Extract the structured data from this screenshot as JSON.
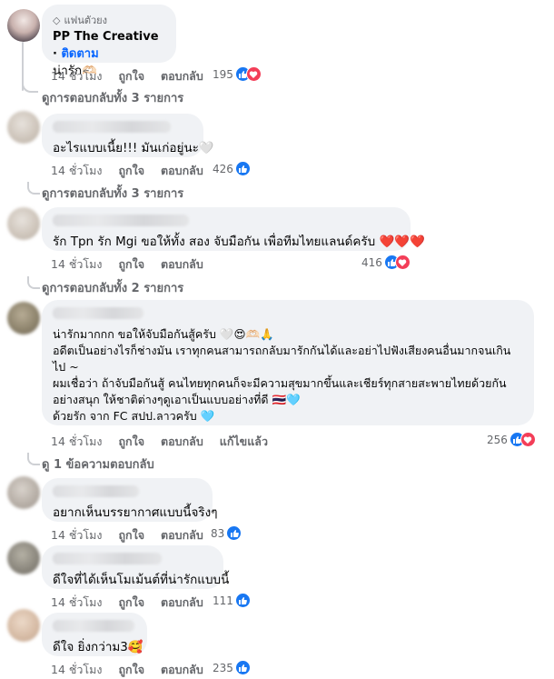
{
  "comments": [
    {
      "badge": "แฟนตัวยง",
      "name": "PP The Creative",
      "follow": "ติดตาม",
      "text": "น่ารัก🫶🏻",
      "time": "14 ชั่วโมง",
      "like": "ถูกใจ",
      "reply": "ตอบกลับ",
      "reaction_count": "195",
      "reaction_types": [
        "like",
        "love"
      ],
      "view_replies": "ดูการตอบกลับทั้ง 3 รายการ"
    },
    {
      "text": "อะไรแบบเนี้ย!!! มันเก่อยู่นะ🤍",
      "time": "14 ชั่วโมง",
      "like": "ถูกใจ",
      "reply": "ตอบกลับ",
      "reaction_count": "426",
      "reaction_types": [
        "like"
      ],
      "view_replies": "ดูการตอบกลับทั้ง 3 รายการ"
    },
    {
      "text": "รัก Tpn รัก Mgi ขอให้ทั้ง สอง จับมือกัน เพื่อทีมไทยแลนด์ครับ ❤️❤️❤️",
      "time": "14 ชั่วโมง",
      "like": "ถูกใจ",
      "reply": "ตอบกลับ",
      "reaction_count": "416",
      "reaction_types": [
        "like",
        "love"
      ],
      "view_replies": "ดูการตอบกลับทั้ง 2 รายการ"
    },
    {
      "lines": [
        "น่ารักมากกก ขอให้จับมือกันสู้ครับ 🤍😍🫶🏻🙏",
        "อดีตเป็นอย่างไรก็ช่างมัน เราทุกคนสามารถกลับมารักกันได้และอย่าไปฟังเสียงคนอื่นมากจนเกิน",
        "ไป ~",
        "ผมเชื่อว่า ถ้าจับมือกันสู้ คนไทยทุกคนก็จะมีความสุขมากขึ้นและเชียร์ทุกสายสะพายไทยด้วยกัน",
        "อย่างสนุก ให้ชาติต่างๆดูเอาเป็นแบบอย่างที่ดี 🇹🇭🩵",
        "ด้วยรัก จาก FC สปป.ลาวครับ 🩵"
      ],
      "time": "14 ชั่วโมง",
      "like": "ถูกใจ",
      "reply": "ตอบกลับ",
      "edited": "แก้ไขแล้ว",
      "reaction_count": "256",
      "reaction_types": [
        "like",
        "love"
      ],
      "view_replies": "ดู 1 ข้อความตอบกลับ"
    },
    {
      "text": "อยากเห็นบรรยากาศแบบนี้จริงๆ",
      "time": "14 ชั่วโมง",
      "like": "ถูกใจ",
      "reply": "ตอบกลับ",
      "reaction_count": "83",
      "reaction_types": [
        "like"
      ]
    },
    {
      "text": "ดีใจที่ได้เห็นโมเม้นต์ที่น่ารักแบบนี้",
      "time": "14 ชั่วโมง",
      "like": "ถูกใจ",
      "reply": "ตอบกลับ",
      "reaction_count": "111",
      "reaction_types": [
        "like"
      ]
    },
    {
      "text": "ดีใจ ยิ่งกว่าม3🥰",
      "time": "14 ชั่วโมง",
      "like": "ถูกใจ",
      "reply": "ตอบกลับ",
      "reaction_count": "235",
      "reaction_types": [
        "like"
      ]
    }
  ],
  "colors": {
    "bubble": "#f0f2f5",
    "secondary_text": "#65676b",
    "like_blue": "#1877f2",
    "love_red": "#f33e58",
    "follow_blue": "#0866ff"
  }
}
